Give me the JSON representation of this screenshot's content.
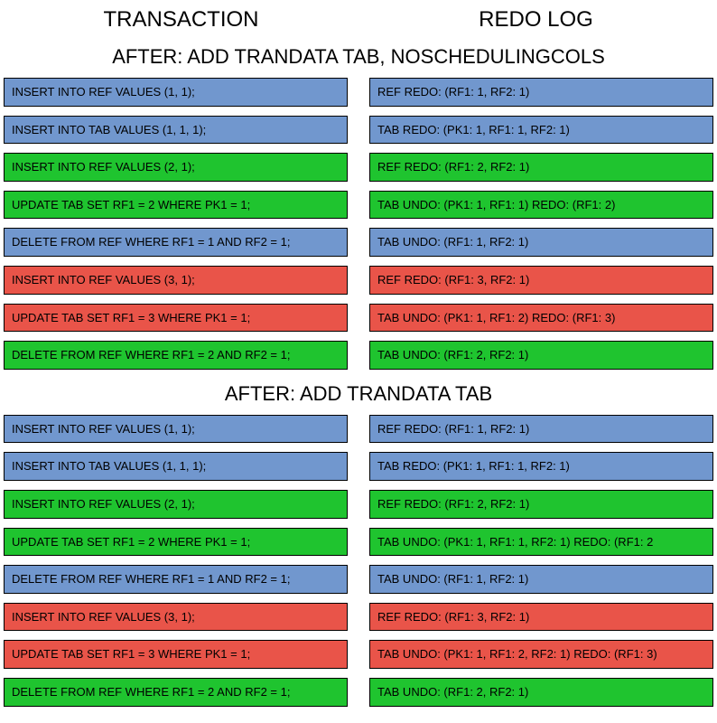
{
  "headers": {
    "transaction": "TRANSACTION",
    "redolog": "REDO LOG"
  },
  "sections": [
    {
      "title": "AFTER: ADD TRANDATA TAB, NOSCHEDULINGCOLS",
      "rows": [
        {
          "color": "blue",
          "tx": "INSERT INTO REF VALUES (1, 1);",
          "log": "REF REDO: (RF1: 1, RF2: 1)"
        },
        {
          "color": "blue",
          "tx": "INSERT INTO TAB VALUES (1, 1, 1);",
          "log": "TAB REDO: (PK1: 1, RF1: 1, RF2: 1)"
        },
        {
          "color": "green",
          "tx": "INSERT INTO REF VALUES (2, 1);",
          "log": "REF REDO: (RF1: 2, RF2: 1)"
        },
        {
          "color": "green",
          "tx": "UPDATE TAB SET RF1 = 2 WHERE PK1 = 1;",
          "log": "TAB UNDO: (PK1: 1, RF1: 1) REDO: (RF1: 2)"
        },
        {
          "color": "blue",
          "tx": "DELETE FROM REF WHERE RF1 = 1 AND RF2 = 1;",
          "log": "TAB UNDO: (RF1: 1, RF2: 1)"
        },
        {
          "color": "red",
          "tx": "INSERT INTO REF VALUES (3, 1);",
          "log": "REF REDO: (RF1: 3, RF2: 1)"
        },
        {
          "color": "red",
          "tx": "UPDATE TAB SET RF1 = 3 WHERE PK1 = 1;",
          "log": "TAB UNDO: (PK1: 1, RF1: 2) REDO: (RF1: 3)"
        },
        {
          "color": "green",
          "tx": "DELETE FROM REF WHERE RF1 = 2 AND RF2 = 1;",
          "log": "TAB UNDO: (RF1: 2, RF2: 1)"
        }
      ]
    },
    {
      "title": "AFTER: ADD TRANDATA TAB",
      "rows": [
        {
          "color": "blue",
          "tx": "INSERT INTO REF VALUES (1, 1);",
          "log": "REF REDO: (RF1: 1, RF2: 1)"
        },
        {
          "color": "blue",
          "tx": "INSERT INTO TAB VALUES (1, 1, 1);",
          "log": "TAB REDO: (PK1: 1, RF1: 1, RF2: 1)"
        },
        {
          "color": "green",
          "tx": "INSERT INTO REF VALUES (2, 1);",
          "log": "REF REDO: (RF1: 2, RF2: 1)"
        },
        {
          "color": "green",
          "tx": "UPDATE TAB SET RF1 = 2 WHERE PK1 = 1;",
          "log": "TAB UNDO: (PK1: 1, RF1: 1, RF2: 1) REDO: (RF1: 2"
        },
        {
          "color": "blue",
          "tx": "DELETE FROM REF WHERE RF1 = 1 AND RF2 = 1;",
          "log": "TAB UNDO: (RF1: 1, RF2: 1)"
        },
        {
          "color": "red",
          "tx": "INSERT INTO REF VALUES (3, 1);",
          "log": "REF REDO: (RF1: 3, RF2: 1)"
        },
        {
          "color": "red",
          "tx": "UPDATE TAB SET RF1 = 3 WHERE PK1 = 1;",
          "log": "TAB UNDO: (PK1: 1, RF1: 2, RF2: 1) REDO: (RF1: 3)"
        },
        {
          "color": "green",
          "tx": "DELETE FROM REF WHERE RF1 = 2 AND RF2 = 1;",
          "log": "TAB UNDO: (RF1: 2, RF2: 1)"
        }
      ]
    }
  ]
}
